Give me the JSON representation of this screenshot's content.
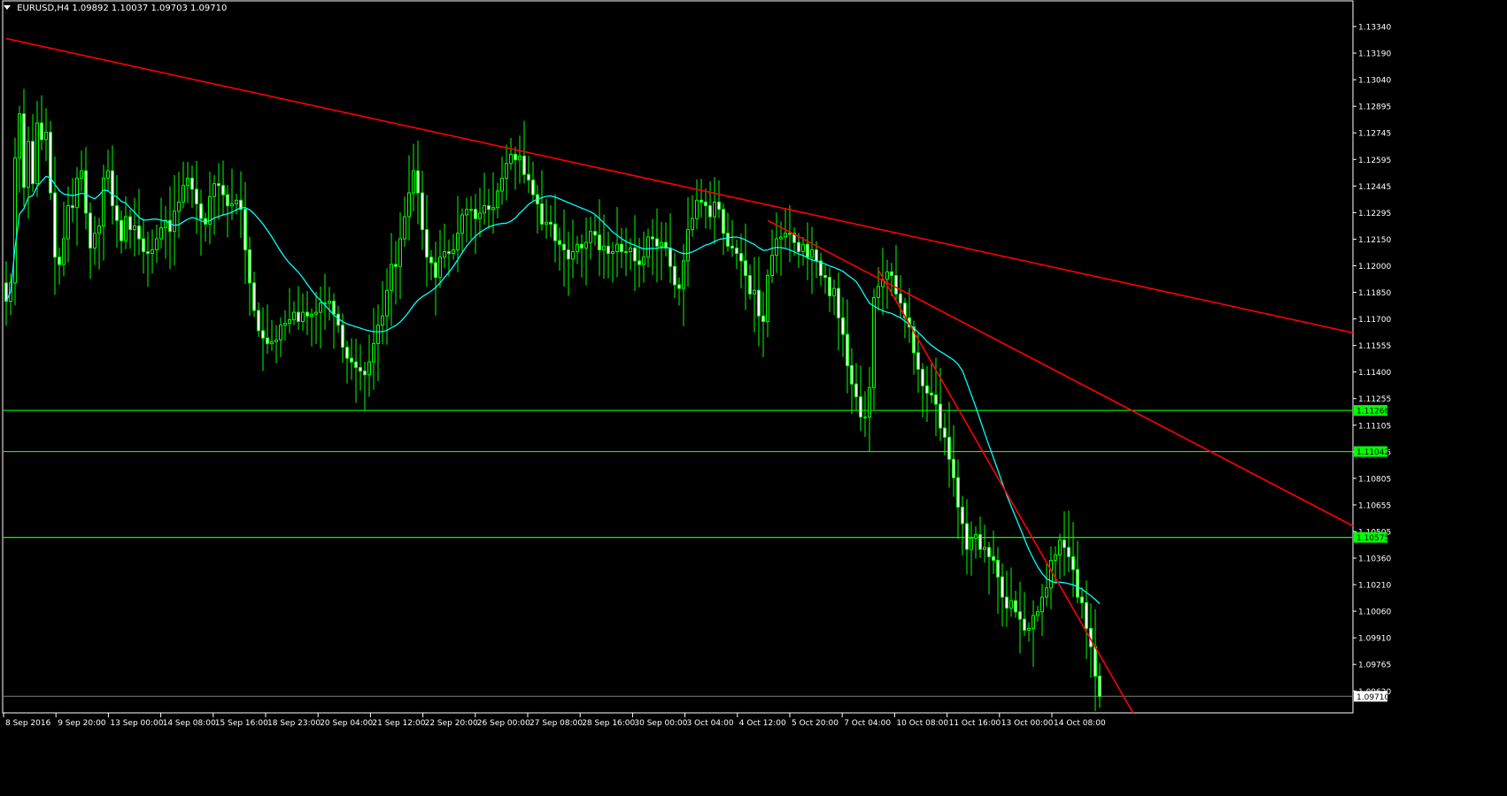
{
  "header": {
    "symbol": "EURUSD,H4",
    "ohlc": "1.09892 1.10037 1.09703 1.09710"
  },
  "colors": {
    "background": "#000000",
    "bull": "#00ff00",
    "bear": "#00ff00",
    "ma": "#00ffff",
    "trendline": "#ff0000",
    "hline": "#00ff00",
    "axis_text": "#ffffff",
    "bid_line": "#808080"
  },
  "price_axis": {
    "labels": [
      "1.13340",
      "1.13190",
      "1.13040",
      "1.12895",
      "1.12745",
      "1.12595",
      "1.12445",
      "1.12295",
      "1.12150",
      "1.12000",
      "1.11850",
      "1.11700",
      "1.11555",
      "1.11400",
      "1.11255",
      "1.11105",
      "1.10955",
      "1.10805",
      "1.10655",
      "1.10505",
      "1.10360",
      "1.10210",
      "1.10060",
      "1.09910",
      "1.09765",
      "1.09620"
    ],
    "hline_tags": [
      "1.11266",
      "1.11042",
      "1.10575"
    ],
    "bid_tag": "1.09710"
  },
  "time_axis": {
    "labels": [
      "8 Sep 2016",
      "9 Sep 20:00",
      "13 Sep 00:00",
      "14 Sep 08:00",
      "15 Sep 16:00",
      "18 Sep 23:00",
      "20 Sep 04:00",
      "21 Sep 12:00",
      "22 Sep 20:00",
      "26 Sep 00:00",
      "27 Sep 08:00",
      "28 Sep 16:00",
      "30 Sep 00:00",
      "3 Oct 04:00",
      "4 Oct 12:00",
      "5 Oct 20:00",
      "7 Oct 04:00",
      "10 Oct 08:00",
      "11 Oct 16:00",
      "13 Oct 00:00",
      "14 Oct 08:00"
    ]
  },
  "chart_data": {
    "type": "candlestick",
    "symbol": "EURUSD",
    "timeframe": "H4",
    "ylim": [
      1.0962,
      1.1349
    ],
    "horizontal_levels": [
      1.11266,
      1.11042,
      1.10575
    ],
    "last_bid": 1.0971,
    "trendlines": [
      {
        "from_index": 0,
        "from_price": 1.1329,
        "to_index": 304,
        "to_price": 1.1169
      },
      {
        "from_index": 172,
        "from_price": 1.123,
        "to_index": 304,
        "to_price": 1.1064
      },
      {
        "from_index": 197,
        "from_price": 1.1203,
        "to_index": 255,
        "to_price": 1.096
      }
    ],
    "closes": [
      1.1186,
      1.1196,
      1.1264,
      1.1288,
      1.1248,
      1.1273,
      1.125,
      1.1283,
      1.1274,
      1.1278,
      1.1245,
      1.121,
      1.1206,
      1.122,
      1.1238,
      1.1237,
      1.1253,
      1.1257,
      1.1234,
      1.1215,
      1.1223,
      1.1227,
      1.1253,
      1.1257,
      1.1238,
      1.123,
      1.1219,
      1.1232,
      1.1225,
      1.1227,
      1.122,
      1.1213,
      1.1212,
      1.1214,
      1.122,
      1.1226,
      1.123,
      1.1224,
      1.1235,
      1.124,
      1.1249,
      1.1253,
      1.1247,
      1.1239,
      1.1231,
      1.1228,
      1.1243,
      1.125,
      1.1249,
      1.1244,
      1.1238,
      1.1239,
      1.1241,
      1.1236,
      1.1214,
      1.1196,
      1.1181,
      1.117,
      1.1166,
      1.1163,
      1.1164,
      1.1165,
      1.1173,
      1.1174,
      1.1176,
      1.118,
      1.1175,
      1.118,
      1.1178,
      1.1179,
      1.118,
      1.1185,
      1.1185,
      1.1186,
      1.1179,
      1.1173,
      1.1161,
      1.1155,
      1.1153,
      1.115,
      1.1148,
      1.1146,
      1.1153,
      1.1163,
      1.1173,
      1.1178,
      1.1192,
      1.1206,
      1.1205,
      1.122,
      1.1232,
      1.1245,
      1.1257,
      1.1245,
      1.1225,
      1.121,
      1.1207,
      1.1199,
      1.121,
      1.1213,
      1.1212,
      1.1214,
      1.1223,
      1.1233,
      1.1236,
      1.1236,
      1.1231,
      1.1234,
      1.1238,
      1.1236,
      1.1237,
      1.1246,
      1.1253,
      1.1261,
      1.1266,
      1.1263,
      1.1265,
      1.1255,
      1.1252,
      1.1244,
      1.1239,
      1.1228,
      1.1229,
      1.1228,
      1.1219,
      1.1217,
      1.1214,
      1.1209,
      1.1213,
      1.1217,
      1.1215,
      1.1218,
      1.1224,
      1.1222,
      1.1214,
      1.1216,
      1.1212,
      1.1213,
      1.1217,
      1.1213,
      1.1213,
      1.1215,
      1.1208,
      1.1206,
      1.121,
      1.1221,
      1.122,
      1.1216,
      1.1218,
      1.1215,
      1.1205,
      1.1195,
      1.1193,
      1.1208,
      1.1225,
      1.1231,
      1.1241,
      1.124,
      1.1238,
      1.1232,
      1.124,
      1.1236,
      1.1223,
      1.1216,
      1.1215,
      1.1212,
      1.1208,
      1.12,
      1.119,
      1.1192,
      1.1178,
      1.1175,
      1.12,
      1.1211,
      1.122,
      1.1221,
      1.1223,
      1.1223,
      1.1218,
      1.1213,
      1.1217,
      1.121,
      1.1214,
      1.1208,
      1.12,
      1.1199,
      1.1189,
      1.1193,
      1.1177,
      1.1168,
      1.1151,
      1.1141,
      1.1134,
      1.1123,
      1.1123,
      1.1139,
      1.1188,
      1.1194,
      1.1198,
      1.1202,
      1.12,
      1.119,
      1.1185,
      1.1177,
      1.1172,
      1.1158,
      1.1149,
      1.114,
      1.1136,
      1.1135,
      1.113,
      1.1117,
      1.1112,
      1.11,
      1.109,
      1.1074,
      1.1065,
      1.1051,
      1.1057,
      1.1059,
      1.1051,
      1.1052,
      1.1047,
      1.1045,
      1.1036,
      1.1025,
      1.1019,
      1.1023,
      1.1017,
      1.1013,
      1.1007,
      1.1008,
      1.1015,
      1.1017,
      1.1025,
      1.103,
      1.1045,
      1.1048,
      1.1056,
      1.1052,
      1.1047,
      1.104,
      1.1025,
      1.1022,
      1.1008,
      1.0998,
      1.0982,
      1.0971
    ],
    "ma_period": 21
  }
}
